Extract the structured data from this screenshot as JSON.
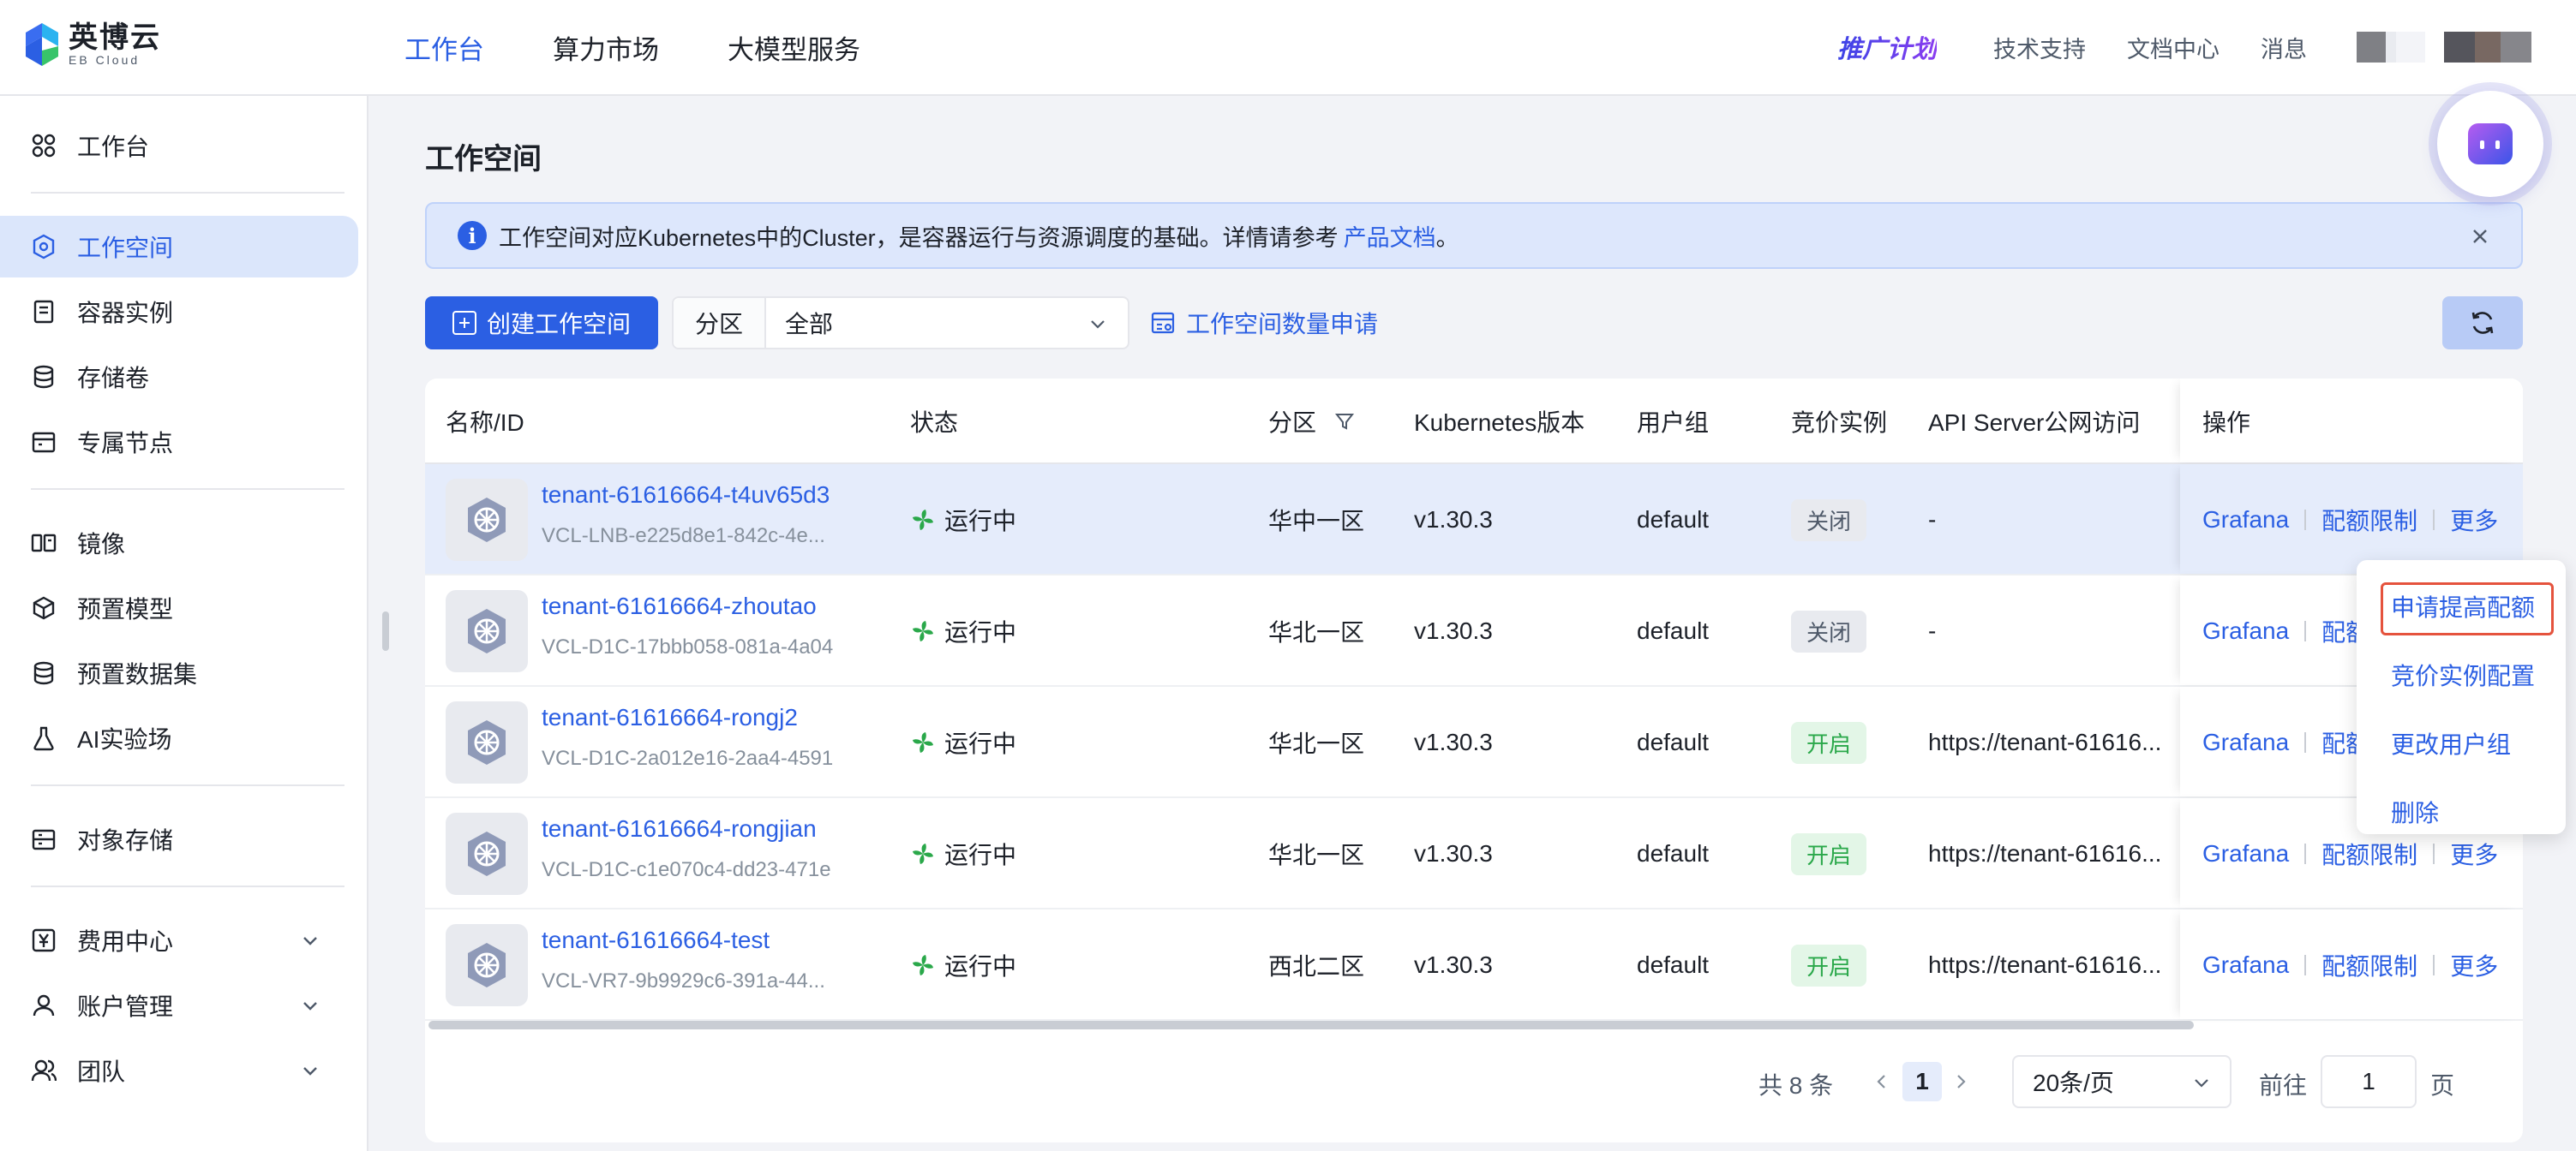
{
  "brand": {
    "name_cn": "英博云",
    "name_en": "EB Cloud"
  },
  "topnav": {
    "menu": [
      {
        "label": "工作台",
        "active": true
      },
      {
        "label": "算力市场",
        "active": false
      },
      {
        "label": "大模型服务",
        "active": false
      }
    ],
    "promo": "推广计划",
    "links": [
      "技术支持",
      "文档中心",
      "消息"
    ]
  },
  "sidebar": {
    "items": [
      {
        "label": "工作台",
        "icon": "grid-icon"
      },
      {
        "label": "工作空间",
        "icon": "cluster-icon",
        "active": true
      },
      {
        "label": "容器实例",
        "icon": "container-icon"
      },
      {
        "label": "存储卷",
        "icon": "database-icon"
      },
      {
        "label": "专属节点",
        "icon": "node-icon"
      },
      {
        "label": "镜像",
        "icon": "image-icon"
      },
      {
        "label": "预置模型",
        "icon": "cube-icon"
      },
      {
        "label": "预置数据集",
        "icon": "dataset-icon"
      },
      {
        "label": "AI实验场",
        "icon": "flask-icon"
      },
      {
        "label": "对象存储",
        "icon": "bucket-icon"
      },
      {
        "label": "费用中心",
        "icon": "yen-icon",
        "expandable": true
      },
      {
        "label": "账户管理",
        "icon": "user-icon",
        "expandable": true
      },
      {
        "label": "团队",
        "icon": "team-icon",
        "expandable": true
      }
    ]
  },
  "page": {
    "title": "工作空间",
    "notice": {
      "text": "工作空间对应Kubernetes中的Cluster，是容器运行与资源调度的基础。详情请参考",
      "link": "产品文档",
      "tail": "。"
    },
    "toolbar": {
      "create_label": "创建工作空间",
      "zone_label": "分区",
      "zone_value": "全部",
      "quota_link": "工作空间数量申请"
    }
  },
  "table": {
    "columns": [
      "名称/ID",
      "状态",
      "分区",
      "Kubernetes版本",
      "用户组",
      "竞价实例",
      "API Server公网访问",
      "操作"
    ],
    "rows": [
      {
        "name": "tenant-61616664-t4uv65d3",
        "id": "VCL-LNB-e225d8e1-842c-4e...",
        "status": "运行中",
        "zone": "华中一区",
        "k8s": "v1.30.3",
        "group": "default",
        "spot": "关闭",
        "api": "-"
      },
      {
        "name": "tenant-61616664-zhoutao",
        "id": "VCL-D1C-17bbb058-081a-4a04",
        "status": "运行中",
        "zone": "华北一区",
        "k8s": "v1.30.3",
        "group": "default",
        "spot": "关闭",
        "api": "-"
      },
      {
        "name": "tenant-61616664-rongj2",
        "id": "VCL-D1C-2a012e16-2aa4-4591",
        "status": "运行中",
        "zone": "华北一区",
        "k8s": "v1.30.3",
        "group": "default",
        "spot": "开启",
        "api": "https://tenant-61616..."
      },
      {
        "name": "tenant-61616664-rongjian",
        "id": "VCL-D1C-c1e070c4-dd23-471e",
        "status": "运行中",
        "zone": "华北一区",
        "k8s": "v1.30.3",
        "group": "default",
        "spot": "开启",
        "api": "https://tenant-61616..."
      },
      {
        "name": "tenant-61616664-test",
        "id": "VCL-VR7-9b9929c6-391a-44...",
        "status": "运行中",
        "zone": "西北二区",
        "k8s": "v1.30.3",
        "group": "default",
        "spot": "开启",
        "api": "https://tenant-61616..."
      }
    ],
    "ops": {
      "grafana": "Grafana",
      "quota": "配额限制",
      "more": "更多"
    }
  },
  "pagination": {
    "total": "共 8 条",
    "current_page": "1",
    "page_size": "20条/页",
    "goto_label": "前往",
    "goto_value": "1",
    "page_unit": "页"
  },
  "more_menu": {
    "items": [
      "申请提高配额",
      "竞价实例配置",
      "更改用户组",
      "删除"
    ]
  },
  "colors": {
    "accent": "#2b5fe3",
    "running": "#2aa84a",
    "highlight_border": "#e5533d"
  }
}
